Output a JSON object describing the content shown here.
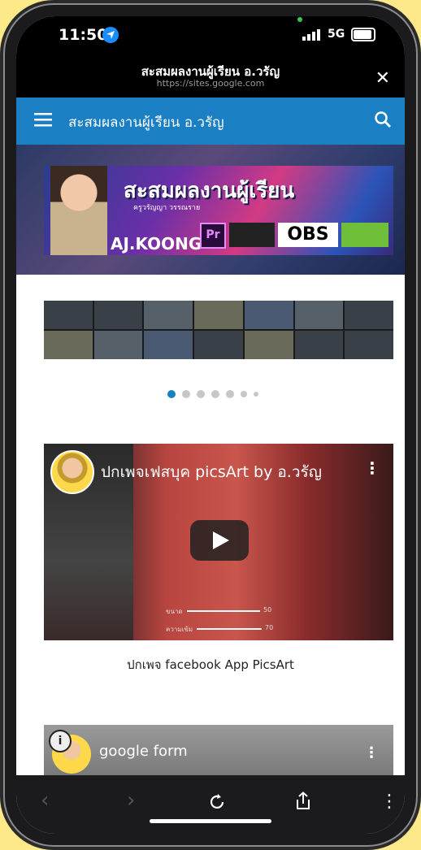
{
  "status": {
    "time": "11:50",
    "network": "5G"
  },
  "browser": {
    "title": "สะสมผลงานผู้เรียน อ.วรัญ",
    "url": "https://sites.google.com",
    "close_label": "✕"
  },
  "appbar": {
    "title": "สะสมผลงานผู้เรียน อ.วรัญ"
  },
  "banner": {
    "title": "สะสมผลงานผู้เรียน",
    "subtitle": "ครูวรัญญา วรรณราย",
    "name": "AJ.KOONG",
    "pr_label": "Pr",
    "obs_label": "OBS"
  },
  "carousel": {
    "page_count": 7,
    "active_index": 0
  },
  "video1": {
    "title": "ปกเพจเฟสบุค picsArt by อ.วรัญ",
    "caption": "ปกเพจ facebook  App PicsArt"
  },
  "video2": {
    "title": "google form"
  },
  "icons": {
    "menu": "menu-icon",
    "search": "search-icon",
    "play": "play-icon",
    "back": "chevron-left-icon",
    "forward": "chevron-right-icon",
    "reload": "reload-icon",
    "share": "share-icon",
    "more": "more-vertical-icon"
  },
  "colors": {
    "appbar": "#1b7fc4",
    "page_background": "#fde98a",
    "carousel_active": "#1b7fc4"
  }
}
